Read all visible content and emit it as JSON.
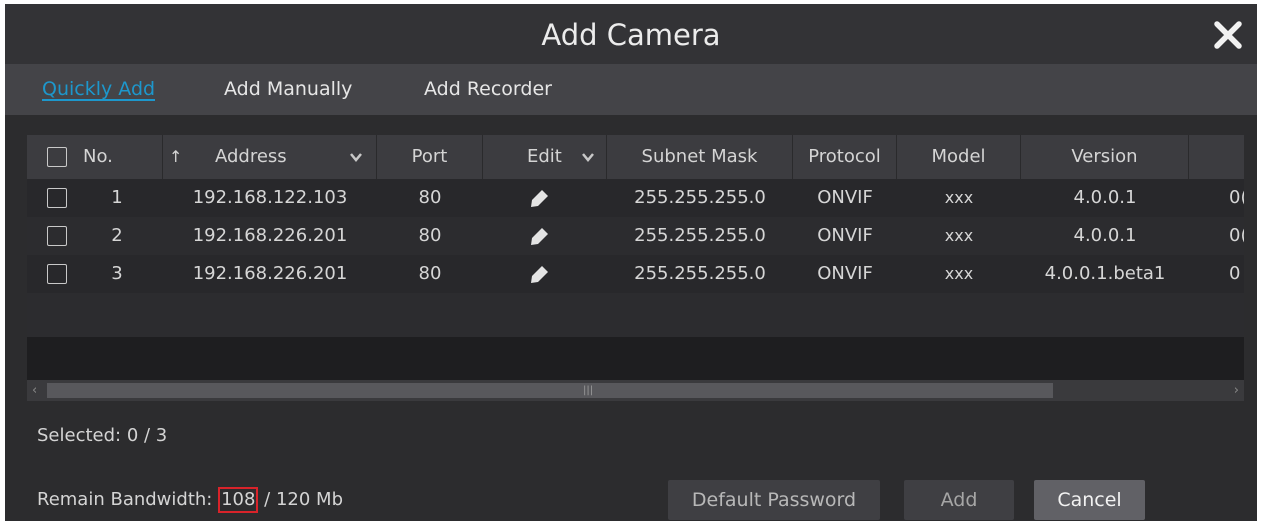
{
  "dialog": {
    "title": "Add Camera"
  },
  "tabs": [
    {
      "label": "Quickly Add",
      "active": true
    },
    {
      "label": "Add Manually",
      "active": false
    },
    {
      "label": "Add Recorder",
      "active": false
    }
  ],
  "table": {
    "headers": {
      "no": "No.",
      "address": "Address",
      "port": "Port",
      "edit": "Edit",
      "subnet_mask": "Subnet Mask",
      "protocol": "Protocol",
      "model": "Model",
      "version": "Version"
    },
    "rows": [
      {
        "no": "1",
        "address": "192.168.122.103",
        "port": "80",
        "subnet_mask": "255.255.255.0",
        "protocol": "ONVIF",
        "model": "xxx",
        "version": "4.0.0.1",
        "extra": "0("
      },
      {
        "no": "2",
        "address": "192.168.226.201",
        "port": "80",
        "subnet_mask": "255.255.255.0",
        "protocol": "ONVIF",
        "model": "xxx",
        "version": "4.0.0.1",
        "extra": "0("
      },
      {
        "no": "3",
        "address": "192.168.226.201",
        "port": "80",
        "subnet_mask": "255.255.255.0",
        "protocol": "ONVIF",
        "model": "xxx",
        "version": "4.0.0.1.beta1",
        "extra": "0"
      }
    ]
  },
  "status": {
    "selected": "Selected: 0 / 3",
    "bandwidth_label": "Remain Bandwidth: ",
    "bandwidth_value": "108",
    "bandwidth_total": " / 120 Mb"
  },
  "buttons": {
    "default_password": "Default Password",
    "add": "Add",
    "cancel": "Cancel"
  },
  "colors": {
    "accent": "#1d97cc",
    "highlight_box": "#d8232a"
  }
}
